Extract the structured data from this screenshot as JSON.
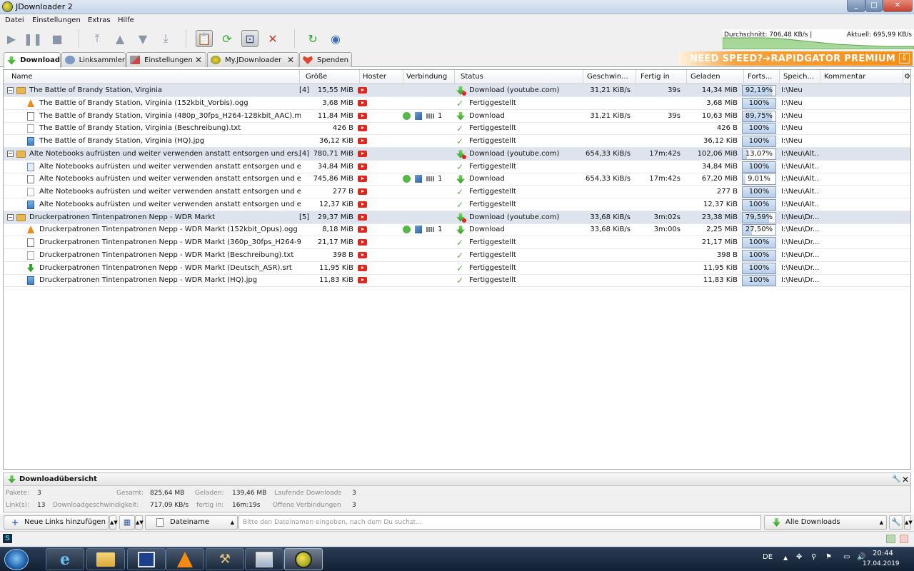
{
  "window": {
    "title": "JDownloader 2"
  },
  "menu": [
    "Datei",
    "Einstellungen",
    "Extras",
    "Hilfe"
  ],
  "speed": {
    "average": "Durchschnitt: 706,48 KB/s |",
    "current": "Aktuell: 695,99 KB/s"
  },
  "tabs": [
    {
      "label": "Download",
      "active": true,
      "closable": false
    },
    {
      "label": "Linksammler",
      "active": false,
      "closable": false
    },
    {
      "label": "Einstellungen",
      "active": false,
      "closable": true
    },
    {
      "label": "My.JDownloader",
      "active": false,
      "closable": true
    },
    {
      "label": "Spenden",
      "active": false,
      "closable": false
    }
  ],
  "promo": "NEED SPEED?➔RAPIDGATOR PREMIUM",
  "columns": {
    "name": "Name",
    "size": "Größe",
    "hoster": "Hoster",
    "connection": "Verbindung",
    "status": "Status",
    "speed": "Geschwin...",
    "eta": "Fertig in",
    "loaded": "Geladen",
    "progress": "Forts...",
    "save": "Speich...",
    "comment": "Kommentar"
  },
  "rows": [
    {
      "type": "pkg",
      "name": "The Battle of Brandy Station, Virginia",
      "count": "[4]",
      "size": "15,55 MiB",
      "status": "Download (youtube.com)",
      "speed": "31,21 KiB/s",
      "eta": "39s",
      "loaded": "14,34 MiB",
      "progress": "92,19%",
      "pct": 92.19,
      "save": "I:\\Neu"
    },
    {
      "type": "file",
      "icon": "vlc",
      "name": "The Battle of Brandy Station, Virginia (152kbit_Vorbis).ogg",
      "size": "3,68 MiB",
      "status": "Fertiggestellt",
      "speed": "",
      "eta": "",
      "loaded": "3,68 MiB",
      "progress": "100%",
      "pct": 100,
      "save": "I:\\Neu"
    },
    {
      "type": "file",
      "icon": "video",
      "name": "The Battle of Brandy Station, Virginia (480p_30fps_H264-128kbit_AAC).mp4",
      "size": "11,84 MiB",
      "conn": "1",
      "status": "Download",
      "speed": "31,21 KiB/s",
      "eta": "39s",
      "loaded": "10,63 MiB",
      "progress": "89,75%",
      "pct": 89.75,
      "save": "I:\\Neu"
    },
    {
      "type": "file",
      "icon": "text",
      "name": "The Battle of Brandy Station, Virginia (Beschreibung).txt",
      "size": "426 B",
      "status": "Fertiggestellt",
      "speed": "",
      "eta": "",
      "loaded": "426 B",
      "progress": "100%",
      "pct": 100,
      "save": "I:\\Neu"
    },
    {
      "type": "file",
      "icon": "image",
      "name": "The Battle of Brandy Station, Virginia (HQ).jpg",
      "size": "36,12 KiB",
      "status": "Fertiggestellt",
      "speed": "",
      "eta": "",
      "loaded": "36,12 KiB",
      "progress": "100%",
      "pct": 100,
      "save": "I:\\Neu"
    },
    {
      "type": "pkg",
      "name": "Alte Notebooks aufrüsten und weiter verwenden anstatt entsorgen und ers...",
      "count": "[4]",
      "size": "780,71 MiB",
      "status": "Download (youtube.com)",
      "speed": "654,33 KiB/s",
      "eta": "17m:42s",
      "loaded": "102,06 MiB",
      "progress": "13,07%",
      "pct": 13.07,
      "save": "I:\\Neu\\Alt..."
    },
    {
      "type": "file",
      "icon": "audio",
      "name": "Alte Notebooks aufrüsten und weiter verwenden anstatt entsorgen und ersetz...",
      "size": "34,84 MiB",
      "status": "Fertiggestellt",
      "speed": "",
      "eta": "",
      "loaded": "34,84 MiB",
      "progress": "100%",
      "pct": 100,
      "save": "I:\\Neu\\Alt..."
    },
    {
      "type": "file",
      "icon": "video",
      "name": "Alte Notebooks aufrüsten und weiter verwenden anstatt entsorgen und ersetz...",
      "size": "745,86 MiB",
      "conn": "1",
      "status": "Download",
      "speed": "654,33 KiB/s",
      "eta": "17m:42s",
      "loaded": "67,20 MiB",
      "progress": "9,01%",
      "pct": 9.01,
      "save": "I:\\Neu\\Alt..."
    },
    {
      "type": "file",
      "icon": "text",
      "name": "Alte Notebooks aufrüsten und weiter verwenden anstatt entsorgen und ersetz...",
      "size": "277 B",
      "status": "Fertiggestellt",
      "speed": "",
      "eta": "",
      "loaded": "277 B",
      "progress": "100%",
      "pct": 100,
      "save": "I:\\Neu\\Alt..."
    },
    {
      "type": "file",
      "icon": "image",
      "name": "Alte Notebooks aufrüsten und weiter verwenden anstatt entsorgen und ersetz...",
      "size": "12,37 KiB",
      "status": "Fertiggestellt",
      "speed": "",
      "eta": "",
      "loaded": "12,37 KiB",
      "progress": "100%",
      "pct": 100,
      "save": "I:\\Neu\\Alt..."
    },
    {
      "type": "pkg",
      "name": "Druckerpatronen Tintenpatronen Nepp - WDR Markt",
      "count": "[5]",
      "size": "29,37 MiB",
      "status": "Download (youtube.com)",
      "speed": "33,68 KiB/s",
      "eta": "3m:02s",
      "loaded": "23,38 MiB",
      "progress": "79,59%",
      "pct": 79.59,
      "save": "I:\\Neu\\Dr..."
    },
    {
      "type": "file",
      "icon": "vlc",
      "name": "Druckerpatronen Tintenpatronen Nepp - WDR Markt (152kbit_Opus).ogg",
      "size": "8,18 MiB",
      "conn": "1",
      "status": "Download",
      "speed": "33,68 KiB/s",
      "eta": "3m:00s",
      "loaded": "2,25 MiB",
      "progress": "27,50%",
      "pct": 27.5,
      "save": "I:\\Neu\\Dr..."
    },
    {
      "type": "file",
      "icon": "video",
      "name": "Druckerpatronen Tintenpatronen Nepp - WDR Markt (360p_30fps_H264-96kbit...",
      "size": "21,17 MiB",
      "status": "Fertiggestellt",
      "speed": "",
      "eta": "",
      "loaded": "21,17 MiB",
      "progress": "100%",
      "pct": 100,
      "save": "I:\\Neu\\Dr..."
    },
    {
      "type": "file",
      "icon": "text",
      "name": "Druckerpatronen Tintenpatronen Nepp - WDR Markt (Beschreibung).txt",
      "size": "398 B",
      "status": "Fertiggestellt",
      "speed": "",
      "eta": "",
      "loaded": "398 B",
      "progress": "100%",
      "pct": 100,
      "save": "I:\\Neu\\Dr..."
    },
    {
      "type": "file",
      "icon": "subtitle",
      "name": "Druckerpatronen Tintenpatronen Nepp - WDR Markt (Deutsch_ASR).srt",
      "size": "11,95 KiB",
      "status": "Fertiggestellt",
      "speed": "",
      "eta": "",
      "loaded": "11,95 KiB",
      "progress": "100%",
      "pct": 100,
      "save": "I:\\Neu\\Dr..."
    },
    {
      "type": "file",
      "icon": "image",
      "name": "Druckerpatronen Tintenpatronen Nepp - WDR Markt (HQ).jpg",
      "size": "11,83 KiB",
      "status": "Fertiggestellt",
      "speed": "",
      "eta": "",
      "loaded": "11,83 KiB",
      "progress": "100%",
      "pct": 100,
      "save": "I:\\Neu\\Dr..."
    }
  ],
  "overview": {
    "title": "Downloadübersicht",
    "packages_label": "Pakete:",
    "packages": "3",
    "total_label": "Gesamt:",
    "total": "825,64 MB",
    "loaded_label": "Geladen:",
    "loaded": "139,46 MB",
    "running_label": "Laufende Downloads",
    "running": "3",
    "links_label": "Link(s):",
    "links": "13",
    "speed_label": "Downloadgeschwindigkeit:",
    "speed": "717,09 KB/s",
    "eta_label": "fertig in:",
    "eta": "16m:19s",
    "open_label": "Offene Verbindungen",
    "open": "3"
  },
  "bottom": {
    "add_links": "Neue Links hinzufügen",
    "filter_field": "Dateiname",
    "search_placeholder": "Bitte den Dateinamen eingeben, nach dem Du suchst...",
    "view": "Alle Downloads"
  },
  "taskbar": {
    "lang": "DE",
    "time": "20:44",
    "date": "17.04.2019"
  },
  "colors": {
    "accent": "#e8231a",
    "pkg_row": "#dde4ee",
    "promo": "#f58d16"
  }
}
